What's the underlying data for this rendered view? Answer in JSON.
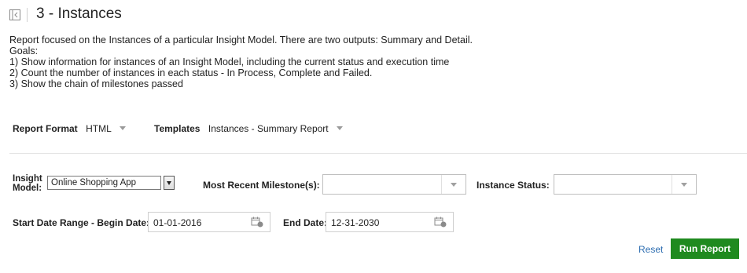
{
  "header": {
    "title": "3 - Instances",
    "icon": "sidebar-toggle-icon"
  },
  "description": {
    "lines": [
      "Report focused on the Instances of a particular Insight Model. There are two outputs: Summary and Detail.",
      "Goals:",
      "1) Show information for instances of an Insight Model, including the current status and execution time",
      "2) Count the number of instances in each status - In Process, Complete and Failed.",
      "3) Show the chain of milestones passed"
    ]
  },
  "report_options": {
    "format_label": "Report Format",
    "format_value": "HTML",
    "templates_label": "Templates",
    "templates_value": "Instances - Summary Report"
  },
  "filters": {
    "insight_model_label_line1": "Insight",
    "insight_model_label_line2": "Model:",
    "insight_model_value": "Online Shopping App",
    "milestone_label": "Most Recent Milestone(s):",
    "milestone_value": "",
    "instance_status_label": "Instance Status:",
    "instance_status_value": "",
    "start_date_label": "Start Date Range - Begin Date:",
    "start_date_value": "01-01-2016",
    "end_date_label": "End Date:",
    "end_date_value": "12-31-2030"
  },
  "actions": {
    "reset_label": "Reset",
    "run_label": "Run Report"
  },
  "colors": {
    "run_button": "#1f8a1f",
    "reset_link": "#2b6cb0"
  }
}
